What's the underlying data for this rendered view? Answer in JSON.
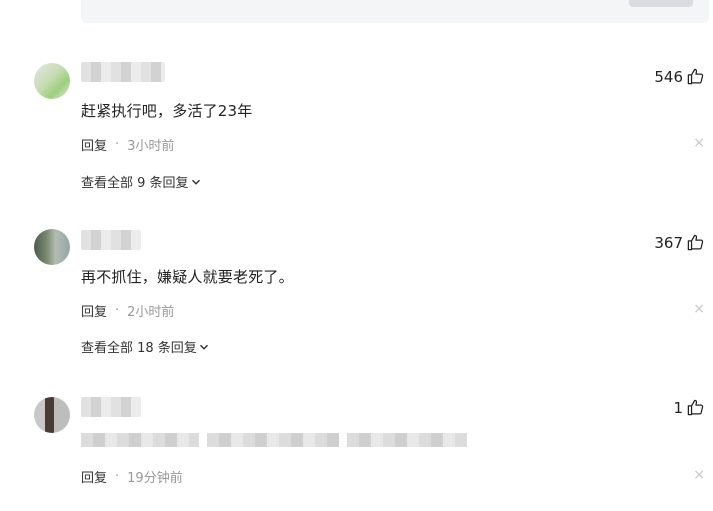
{
  "comments": [
    {
      "likes": "546",
      "text": "赶紧执行吧，多活了23年",
      "reply_label": "回复",
      "separator": "·",
      "time": "3小时前",
      "more_replies": "查看全部 9 条回复",
      "close_glyph": "×"
    },
    {
      "likes": "367",
      "text": "再不抓住，嫌疑人就要老死了。",
      "reply_label": "回复",
      "separator": "·",
      "time": "2小时前",
      "more_replies": "查看全部 18 条回复",
      "close_glyph": "×"
    },
    {
      "likes": "1",
      "reply_label": "回复",
      "separator": "·",
      "time": "19分钟前",
      "close_glyph": "×"
    }
  ],
  "icons": {
    "like": "thumbs-up-icon",
    "close": "close-icon",
    "expand": "chevron-down-icon"
  }
}
